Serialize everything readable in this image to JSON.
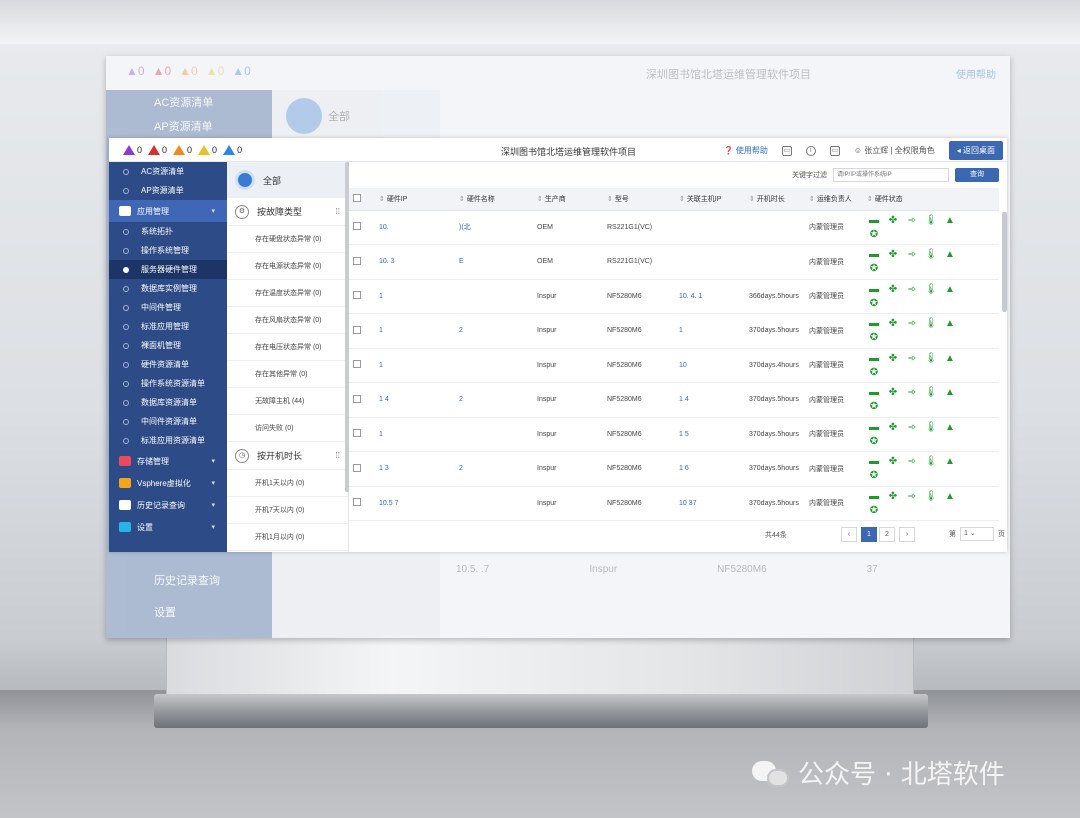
{
  "alerts": [
    {
      "count": "0",
      "color": "#8a3ad6"
    },
    {
      "count": "0",
      "color": "#d92e2e"
    },
    {
      "count": "0",
      "color": "#f08a1c"
    },
    {
      "count": "0",
      "color": "#e6c227"
    },
    {
      "count": "0",
      "color": "#2d86e0"
    }
  ],
  "app_title": "深圳图书馆北塔运维管理软件项目",
  "top_right": {
    "help": "使用帮助",
    "user": "张立辉 | 全权限角色",
    "back_button": "返回桌面"
  },
  "ghost": {
    "title": "深圳图书馆北塔运维管理软件项目",
    "help": "使用帮助",
    "side_items": [
      "AC资源清单",
      "AP资源清单"
    ],
    "all_label": "全部",
    "bottom_items": [
      "历史记录查询",
      "设置"
    ],
    "row": [
      "10.5.  .7",
      "Inspur",
      "NF5280M6",
      "37"
    ],
    "mid_item": "开机7天以内"
  },
  "sidebar": {
    "top_items": [
      "AC资源清单",
      "AP资源清单"
    ],
    "group_app": "应用管理",
    "app_items": [
      "系统拓扑",
      "操作系统管理",
      "服务器硬件管理",
      "数据库实例管理",
      "中间件管理",
      "标准应用管理",
      "裸面机管理",
      "硬件资源清单",
      "操作系统资源清单",
      "数据库资源清单",
      "中间件资源清单",
      "标准应用资源清单"
    ],
    "active_index": 2,
    "bottom_groups": [
      {
        "label": "存储管理",
        "color": "#e84a5f"
      },
      {
        "label": "Vsphere虚拟化",
        "color": "#f0a51c"
      },
      {
        "label": "历史记录查询",
        "color": "#ffffff"
      },
      {
        "label": "设置",
        "color": "#27b4e6"
      }
    ]
  },
  "midpanel": {
    "all": "全部",
    "group1": "按故障类型",
    "group1_items": [
      "存在硬盘状态异常 (0)",
      "存在电源状态异常 (0)",
      "存在温度状态异常 (0)",
      "存在风扇状态异常 (0)",
      "存在电压状态异常 (0)",
      "存在其他异常 (0)",
      "无故障主机 (44)",
      "访问失败 (0)"
    ],
    "group2": "按开机时长",
    "group2_items": [
      "开机1天以内 (0)",
      "开机7天以内 (0)",
      "开机1月以内 (0)"
    ]
  },
  "filter": {
    "label": "关键字过滤",
    "placeholder": "请IP/IP或操作系统IP",
    "button": "查询"
  },
  "table": {
    "headers": [
      "硬件IP",
      "硬件名称",
      "生产商",
      "型号",
      "关联主机IP",
      "开机时长",
      "运维负责人",
      "硬件状态"
    ],
    "rows": [
      {
        "ip": "10.",
        "name": "      )(北",
        "maker": "OEM",
        "model": "RS221G1(VC)",
        "host": "",
        "uptime": "",
        "owner": "内蒙管理员"
      },
      {
        "ip": "10.    3",
        "name": "      E",
        "maker": "OEM",
        "model": "RS221G1(VC)",
        "host": "",
        "uptime": "",
        "owner": "内蒙管理员"
      },
      {
        "ip": "1",
        "name": "      ",
        "maker": "Inspur",
        "model": "NF5280M6",
        "host": "10.  4.  1",
        "uptime": "366days.5hours",
        "owner": "内蒙管理员"
      },
      {
        "ip": "1",
        "name": "     2",
        "maker": "Inspur",
        "model": "NF5280M6",
        "host": "1",
        "uptime": "370days.5hours",
        "owner": "内蒙管理员"
      },
      {
        "ip": "1",
        "name": "      ",
        "maker": "Inspur",
        "model": "NF5280M6",
        "host": "10",
        "uptime": "370days.4hours",
        "owner": "内蒙管理员"
      },
      {
        "ip": "1    4",
        "name": "      2",
        "maker": "Inspur",
        "model": "NF5280M6",
        "host": "1     4",
        "uptime": "370days.5hours",
        "owner": "内蒙管理员"
      },
      {
        "ip": "1",
        "name": "      ",
        "maker": "Inspur",
        "model": "NF5280M6",
        "host": "1     5",
        "uptime": "370days.5hours",
        "owner": "内蒙管理员"
      },
      {
        "ip": "1    3",
        "name": "   2",
        "maker": "Inspur",
        "model": "NF5280M6",
        "host": "1     6",
        "uptime": "370days.5hours",
        "owner": "内蒙管理员"
      },
      {
        "ip": "10.5    7",
        "name": "",
        "maker": "Inspur",
        "model": "NF5280M6",
        "host": "10     37",
        "uptime": "370days.5hours",
        "owner": "内蒙管理员"
      }
    ],
    "status_icons": [
      "disk-icon",
      "fan-icon",
      "power-icon",
      "temperature-icon",
      "warning-icon",
      "settings-icon"
    ]
  },
  "pager": {
    "total": "共44条",
    "pages": [
      "1",
      "2"
    ],
    "goto_label": "第",
    "goto_value": "1",
    "goto_suffix": "页"
  },
  "watermark": "公众号 · 北塔软件"
}
